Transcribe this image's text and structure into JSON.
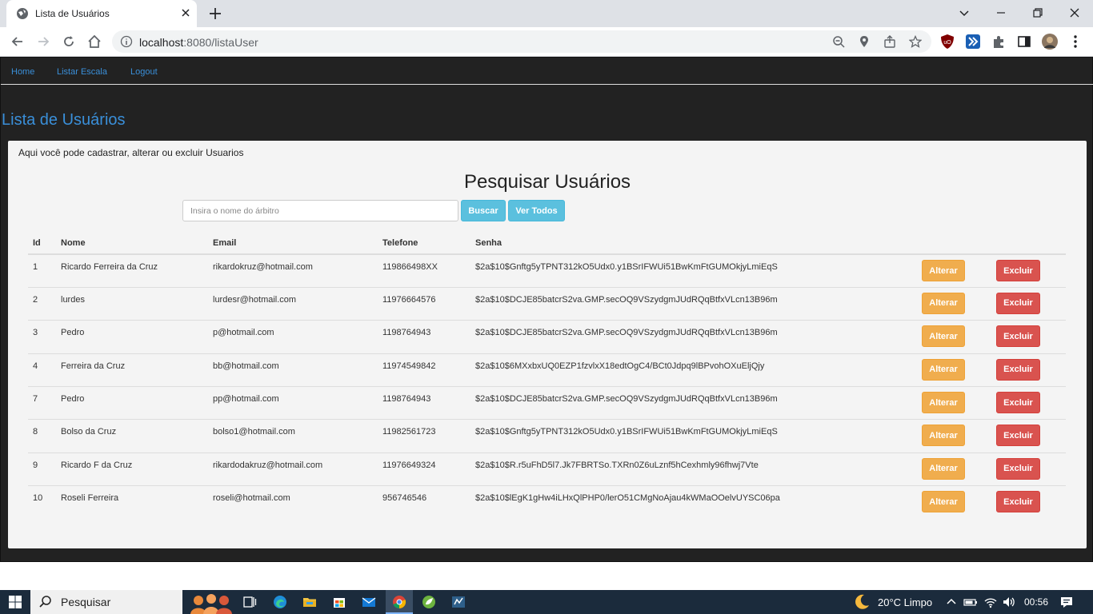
{
  "browser": {
    "tab_title": "Lista de Usuários",
    "url_host": "localhost",
    "url_rest": ":8080/listaUser"
  },
  "navbar": {
    "home": "Home",
    "listar_escala": "Listar Escala",
    "logout": "Logout"
  },
  "page": {
    "title": "Lista de Usuários",
    "intro": "Aqui você pode cadastrar, alterar ou excluir Usuarios",
    "heading": "Pesquisar Usuários"
  },
  "search": {
    "placeholder": "Insira o nome do árbitro",
    "buscar_label": "Buscar",
    "ver_todos_label": "Ver Todos"
  },
  "table": {
    "headers": [
      "Id",
      "Nome",
      "Email",
      "Telefone",
      "Senha"
    ],
    "rows": [
      {
        "id": "1",
        "nome": "Ricardo Ferreira da Cruz",
        "email": "rikardokruz@hotmail.com",
        "telefone": "119866498XX",
        "senha": "$2a$10$Gnftg5yTPNT312kO5Udx0.y1BSrIFWUi51BwKmFtGUMOkjyLmiEqS"
      },
      {
        "id": "2",
        "nome": "lurdes",
        "email": "lurdesr@hotmail.com",
        "telefone": "11976664576",
        "senha": "$2a$10$DCJE85batcrS2va.GMP.secOQ9VSzydgmJUdRQqBtfxVLcn13B96m"
      },
      {
        "id": "3",
        "nome": "Pedro",
        "email": "p@hotmail.com",
        "telefone": "1198764943",
        "senha": "$2a$10$DCJE85batcrS2va.GMP.secOQ9VSzydgmJUdRQqBtfxVLcn13B96m"
      },
      {
        "id": "4",
        "nome": "Ferreira da Cruz",
        "email": "bb@hotmail.com",
        "telefone": "11974549842",
        "senha": "$2a$10$6MXxbxUQ0EZP1fzvlxX18edtOgC4/BCt0Jdpq9lBPvohOXuEljQjy"
      },
      {
        "id": "7",
        "nome": "Pedro",
        "email": "pp@hotmail.com",
        "telefone": "1198764943",
        "senha": "$2a$10$DCJE85batcrS2va.GMP.secOQ9VSzydgmJUdRQqBtfxVLcn13B96m"
      },
      {
        "id": "8",
        "nome": "Bolso da Cruz",
        "email": "bolso1@hotmail.com",
        "telefone": "11982561723",
        "senha": "$2a$10$Gnftg5yTPNT312kO5Udx0.y1BSrIFWUi51BwKmFtGUMOkjyLmiEqS"
      },
      {
        "id": "9",
        "nome": "Ricardo F da Cruz",
        "email": "rikardodakruz@hotmail.com",
        "telefone": "11976649324",
        "senha": "$2a$10$R.r5uFhD5l7.Jk7FBRTSo.TXRn0Z6uLznf5hCexhmly96fhwj7Vte"
      },
      {
        "id": "10",
        "nome": "Roseli Ferreira",
        "email": "roseli@hotmail.com",
        "telefone": "956746546",
        "senha": "$2a$10$lEgK1gHw4iLHxQlPHP0/lerO51CMgNoAjau4kWMaOOelvUYSC06pa"
      }
    ],
    "alterar_label": "Alterar",
    "excluir_label": "Excluir"
  },
  "taskbar": {
    "search_label": "Pesquisar",
    "weather": "20°C  Limpo",
    "time": "00:56"
  },
  "colors": {
    "nav_link": "#3a8fd9",
    "btn_info": "#5bc0de",
    "btn_warning": "#f0ad4e",
    "btn_danger": "#d9534f"
  }
}
